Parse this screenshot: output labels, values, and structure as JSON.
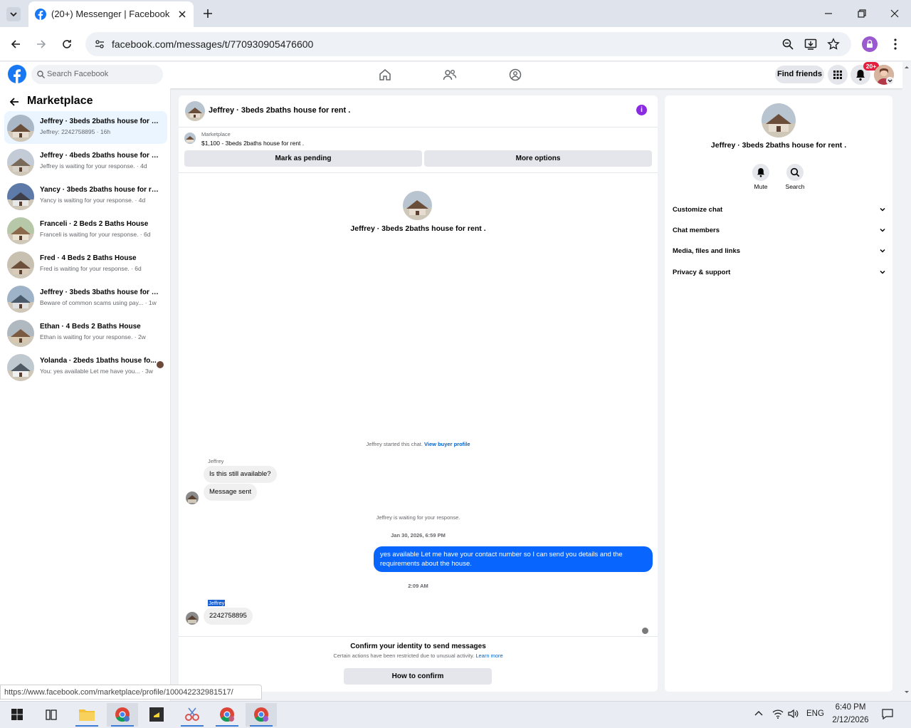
{
  "browser": {
    "tab_title": "(20+) Messenger | Facebook",
    "url": "facebook.com/messages/t/770930905476600",
    "status_url": "https://www.facebook.com/marketplace/profile/100042232981517/"
  },
  "header": {
    "search_placeholder": "Search Facebook",
    "find_friends": "Find friends",
    "notification_badge": "20+"
  },
  "sidebar": {
    "title": "Marketplace",
    "conversations": [
      {
        "title": "Jeffrey · 3beds 2baths house for re...",
        "subtitle": "Jeffrey: 2242758895 · 16h"
      },
      {
        "title": "Jeffrey · 4beds 2baths house for re...",
        "subtitle": "Jeffrey is waiting for your response. · 4d"
      },
      {
        "title": "Yancy · 3beds 2baths house for re...",
        "subtitle": "Yancy is waiting for your response. · 4d"
      },
      {
        "title": "Franceli · 2 Beds 2 Baths House",
        "subtitle": "Franceli is waiting for your response. · 6d"
      },
      {
        "title": "Fred · 4 Beds 2 Baths House",
        "subtitle": "Fred is waiting for your response. · 6d"
      },
      {
        "title": "Jeffrey · 3beds 3baths house for re...",
        "subtitle": "Beware of common scams using pay... · 1w"
      },
      {
        "title": "Ethan · 4 Beds 2 Baths House",
        "subtitle": "Ethan is waiting for your response. · 2w"
      },
      {
        "title": "Yolanda · 2beds 1baths house fo...",
        "subtitle": "You: yes available Let me have you... · 3w"
      }
    ]
  },
  "chat": {
    "header_title": "Jeffrey · 3beds 2baths house for rent .",
    "listing_label": "Marketplace",
    "listing_price": "$1,100 - 3beds 2baths house for rent .",
    "mark_pending": "Mark as pending",
    "more_options": "More options",
    "intro_title": "Jeffrey · 3beds 2baths house for rent .",
    "started_text": "Jeffrey started this chat.",
    "view_profile": "View buyer profile",
    "sender_name": "Jeffrey",
    "msg1": "Is this still available?",
    "msg2": "Message sent",
    "waiting_text": "Jeffrey is waiting for your response.",
    "timestamp1": "Jan 30, 2026, 6:59 PM",
    "my_message": "yes available Let me have your contact number so I can send you details and the requirements about the house.",
    "timestamp2": "2:09 AM",
    "sender_name2": "Jeffrey",
    "msg3": "2242758895",
    "confirm_title": "Confirm your identity to send messages",
    "confirm_sub": "Certain actions have been restricted due to unusual activity.",
    "learn_more": "Learn more",
    "how_to_confirm": "How to confirm"
  },
  "details": {
    "title": "Jeffrey · 3beds 2baths house for rent .",
    "mute": "Mute",
    "search": "Search",
    "sections": [
      "Customize chat",
      "Chat members",
      "Media, files and links",
      "Privacy & support"
    ]
  },
  "taskbar": {
    "time": "6:40 PM",
    "date": "2/12/2026",
    "lang": "ENG"
  },
  "colors": {
    "brand": "#1877f2",
    "my_bubble": "#0866ff",
    "badge": "#e41e3f"
  }
}
